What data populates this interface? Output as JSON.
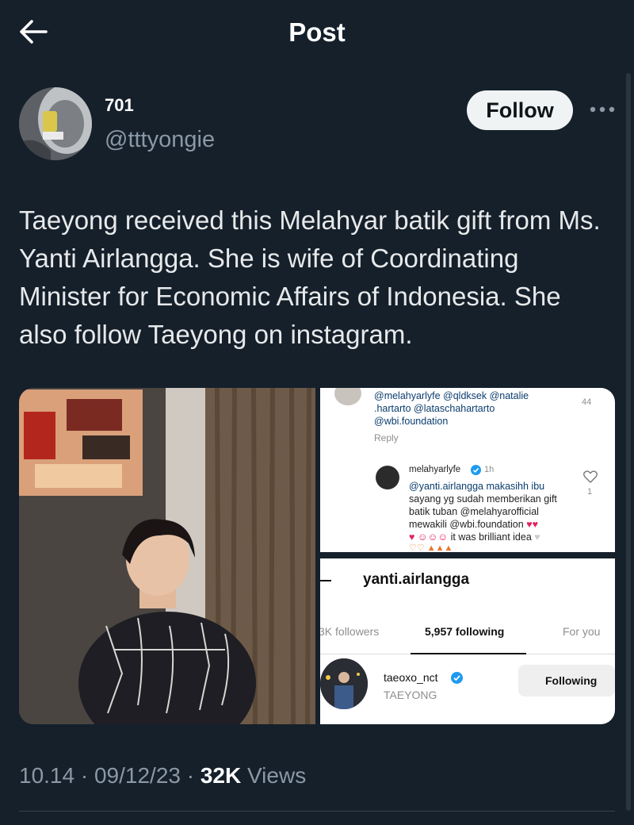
{
  "header": {
    "title": "Post"
  },
  "author": {
    "display_name": "701",
    "handle": "@tttyongie",
    "follow_label": "Follow"
  },
  "tweet": {
    "text": "Taeyong received this Melahyar batik gift  from Ms. Yanti Airlangga. She is wife of Coordinating Minister for Economic Affairs of Indonesia. She also follow Taeyong on instagram."
  },
  "media": {
    "comment_shot": {
      "top_line1": "@melahyarlyfe @qldksek @natalie",
      "top_line2": ".hartarto @lataschahartarto",
      "top_line3": "@wbi.foundation",
      "top_likes": "44",
      "reply_label": "Reply",
      "reply_user": "melahyarlyfe",
      "reply_time": "1h",
      "reply_line1": "@yanti.airlangga makasihh ibu",
      "reply_line2": "sayang yg sudah memberikan gift",
      "reply_line3": "batik tuban @melahyarofficial",
      "reply_line4": "mewakili @wbi.foundation",
      "reply_line5": "it was brilliant idea",
      "reply_likes": "1"
    },
    "profile_shot": {
      "username": "yanti.airlangga",
      "tab_followers": "3K followers",
      "tab_following": "5,957 following",
      "tab_foryou": "For you",
      "row_username": "taeoxo_nct",
      "row_name": "TAEYONG",
      "row_button": "Following"
    }
  },
  "meta": {
    "time": "10.14",
    "date": "09/12/23",
    "views_count": "32K",
    "views_label": "Views",
    "sep": "·"
  },
  "colors": {
    "background": "#15202b",
    "text": "#e7e9ea",
    "secondary": "#8b98a5",
    "follow_bg": "#eff3f4",
    "verified": "#1d9bf0"
  }
}
